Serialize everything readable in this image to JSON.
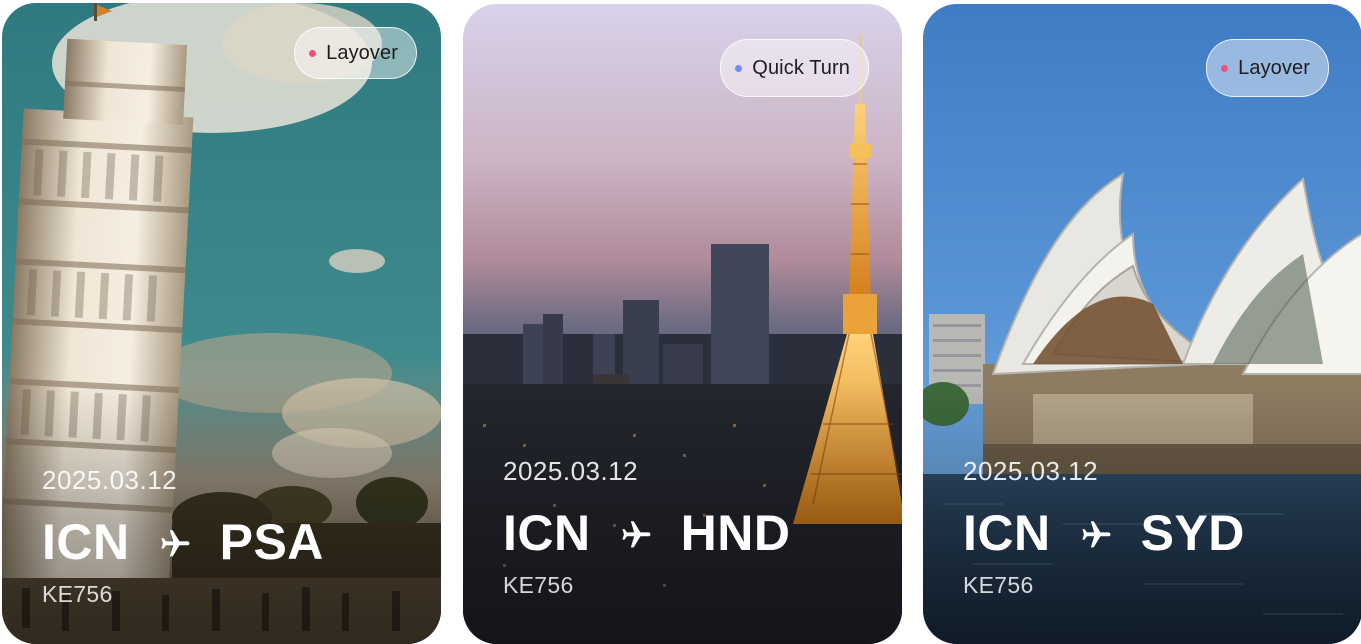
{
  "cards": [
    {
      "badge": {
        "label": "Layover",
        "dot_color": "#f0507a"
      },
      "date": "2025.03.12",
      "origin": "ICN",
      "destination": "PSA",
      "flight": "KE756",
      "scene": "leaning-tower-of-pisa"
    },
    {
      "badge": {
        "label": "Quick Turn",
        "dot_color": "#6d8cff"
      },
      "date": "2025.03.12",
      "origin": "ICN",
      "destination": "HND",
      "flight": "KE756",
      "scene": "tokyo-tower-dusk"
    },
    {
      "badge": {
        "label": "Layover",
        "dot_color": "#f0507a"
      },
      "date": "2025.03.12",
      "origin": "ICN",
      "destination": "SYD",
      "flight": "KE756",
      "scene": "sydney-opera-house"
    }
  ],
  "icons": {
    "route_separator": "airplane-icon"
  }
}
